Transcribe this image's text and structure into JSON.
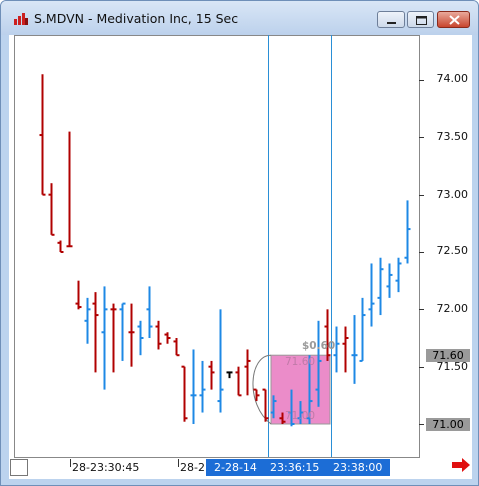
{
  "window": {
    "title": "S.MDVN - Medivation Inc, 15 Sec",
    "buttons": {
      "minimize": "minimize",
      "maximize": "maximize",
      "close": "close"
    }
  },
  "colors": {
    "up_bar": "#1e88e5",
    "down_bar": "#b00000",
    "flat_bar": "#000000",
    "crosshair": "#2a8fd6",
    "measure_box": "#e878c0",
    "time_selection": "#1c6dd6"
  },
  "price_axis": {
    "labels": [
      "74.00",
      "73.50",
      "73.00",
      "72.50",
      "72.00",
      "71.50",
      "71.00"
    ]
  },
  "price_tags": {
    "upper": "71.60",
    "lower": "71.00"
  },
  "measure_tool": {
    "delta": "$0.60",
    "start_value": "71.60",
    "end_value": "71.00"
  },
  "time_axis": {
    "labels": [
      "28-23:30:45",
      "28-2"
    ],
    "selected_labels": [
      "2-28-14",
      "23:36:15",
      "23:38:00"
    ]
  },
  "chart_data": {
    "type": "ohlc",
    "interval": "15 Sec",
    "symbol": "S.MDVN",
    "ylim": [
      70.95,
      74.25
    ],
    "bars": [
      {
        "high": 74.05,
        "low": 73.0,
        "open": 73.52,
        "close": 73.0,
        "dir": "down"
      },
      {
        "high": 73.1,
        "low": 72.65,
        "open": 73.0,
        "close": 72.65,
        "dir": "down"
      },
      {
        "high": 72.6,
        "low": 72.5,
        "open": 72.58,
        "close": 72.5,
        "dir": "down"
      },
      {
        "high": 73.55,
        "low": 72.55,
        "open": 72.55,
        "close": 72.55,
        "dir": "down"
      },
      {
        "high": 72.25,
        "low": 72.0,
        "open": 72.05,
        "close": 72.02,
        "dir": "down"
      },
      {
        "high": 72.1,
        "low": 71.7,
        "open": 71.9,
        "close": 72.0,
        "dir": "up"
      },
      {
        "high": 72.15,
        "low": 71.45,
        "open": 72.05,
        "close": 71.95,
        "dir": "down"
      },
      {
        "high": 72.2,
        "low": 71.3,
        "open": 71.8,
        "close": 72.0,
        "dir": "up"
      },
      {
        "high": 72.05,
        "low": 71.45,
        "open": 72.0,
        "close": 72.0,
        "dir": "down"
      },
      {
        "high": 72.05,
        "low": 71.55,
        "open": 72.0,
        "close": 72.05,
        "dir": "up"
      },
      {
        "high": 72.05,
        "low": 71.5,
        "open": 71.8,
        "close": 71.8,
        "dir": "down"
      },
      {
        "high": 71.9,
        "low": 71.6,
        "open": 71.85,
        "close": 71.75,
        "dir": "up"
      },
      {
        "high": 72.2,
        "low": 71.75,
        "open": 72.0,
        "close": 71.85,
        "dir": "up"
      },
      {
        "high": 71.9,
        "low": 71.65,
        "open": 71.85,
        "close": 71.7,
        "dir": "down"
      },
      {
        "high": 71.8,
        "low": 71.7,
        "open": 71.78,
        "close": 71.75,
        "dir": "down"
      },
      {
        "high": 71.75,
        "low": 71.6,
        "open": 71.72,
        "close": 71.6,
        "dir": "down"
      },
      {
        "high": 71.5,
        "low": 71.02,
        "open": 71.5,
        "close": 71.05,
        "dir": "down"
      },
      {
        "high": 71.65,
        "low": 71.0,
        "open": 71.25,
        "close": 71.25,
        "dir": "up"
      },
      {
        "high": 71.55,
        "low": 71.1,
        "open": 71.25,
        "close": 71.3,
        "dir": "up"
      },
      {
        "high": 71.55,
        "low": 71.3,
        "open": 71.5,
        "close": 71.45,
        "dir": "down"
      },
      {
        "high": 72.0,
        "low": 71.1,
        "open": 71.2,
        "close": 71.3,
        "dir": "up"
      },
      {
        "high": 71.45,
        "low": 71.4,
        "open": 71.45,
        "close": 71.45,
        "dir": "flat"
      },
      {
        "high": 71.5,
        "low": 71.25,
        "open": 71.45,
        "close": 71.25,
        "dir": "down"
      },
      {
        "high": 71.65,
        "low": 71.25,
        "open": 71.5,
        "close": 71.55,
        "dir": "down"
      },
      {
        "high": 71.3,
        "low": 71.2,
        "open": 71.3,
        "close": 71.25,
        "dir": "down"
      },
      {
        "high": 71.3,
        "low": 71.02,
        "open": 71.3,
        "close": 71.05,
        "dir": "down"
      },
      {
        "high": 71.25,
        "low": 71.05,
        "open": 71.1,
        "close": 71.2,
        "dir": "up"
      },
      {
        "high": 71.1,
        "low": 71.0,
        "open": 71.05,
        "close": 71.02,
        "dir": "down"
      },
      {
        "high": 71.3,
        "low": 70.98,
        "open": 71.1,
        "close": 71.0,
        "dir": "up"
      },
      {
        "high": 71.2,
        "low": 71.0,
        "open": 71.05,
        "close": 71.1,
        "dir": "up"
      },
      {
        "high": 71.6,
        "low": 71.0,
        "open": 71.05,
        "close": 71.2,
        "dir": "up"
      },
      {
        "high": 71.9,
        "low": 71.15,
        "open": 71.3,
        "close": 71.55,
        "dir": "up"
      },
      {
        "high": 72.0,
        "low": 71.55,
        "open": 71.85,
        "close": 71.6,
        "dir": "down"
      },
      {
        "high": 71.85,
        "low": 71.45,
        "open": 71.6,
        "close": 71.7,
        "dir": "up"
      },
      {
        "high": 71.85,
        "low": 71.45,
        "open": 71.7,
        "close": 71.75,
        "dir": "down"
      },
      {
        "high": 71.95,
        "low": 71.35,
        "open": 71.6,
        "close": 71.6,
        "dir": "up"
      },
      {
        "high": 72.1,
        "low": 71.55,
        "open": 71.55,
        "close": 71.95,
        "dir": "up"
      },
      {
        "high": 72.4,
        "low": 71.85,
        "open": 72.0,
        "close": 72.05,
        "dir": "up"
      },
      {
        "high": 72.45,
        "low": 71.95,
        "open": 72.1,
        "close": 72.35,
        "dir": "up"
      },
      {
        "high": 72.4,
        "low": 72.1,
        "open": 72.2,
        "close": 72.3,
        "dir": "up"
      },
      {
        "high": 72.45,
        "low": 72.15,
        "open": 72.25,
        "close": 72.4,
        "dir": "up"
      },
      {
        "high": 72.95,
        "low": 72.4,
        "open": 72.45,
        "close": 72.7,
        "dir": "up"
      }
    ]
  }
}
